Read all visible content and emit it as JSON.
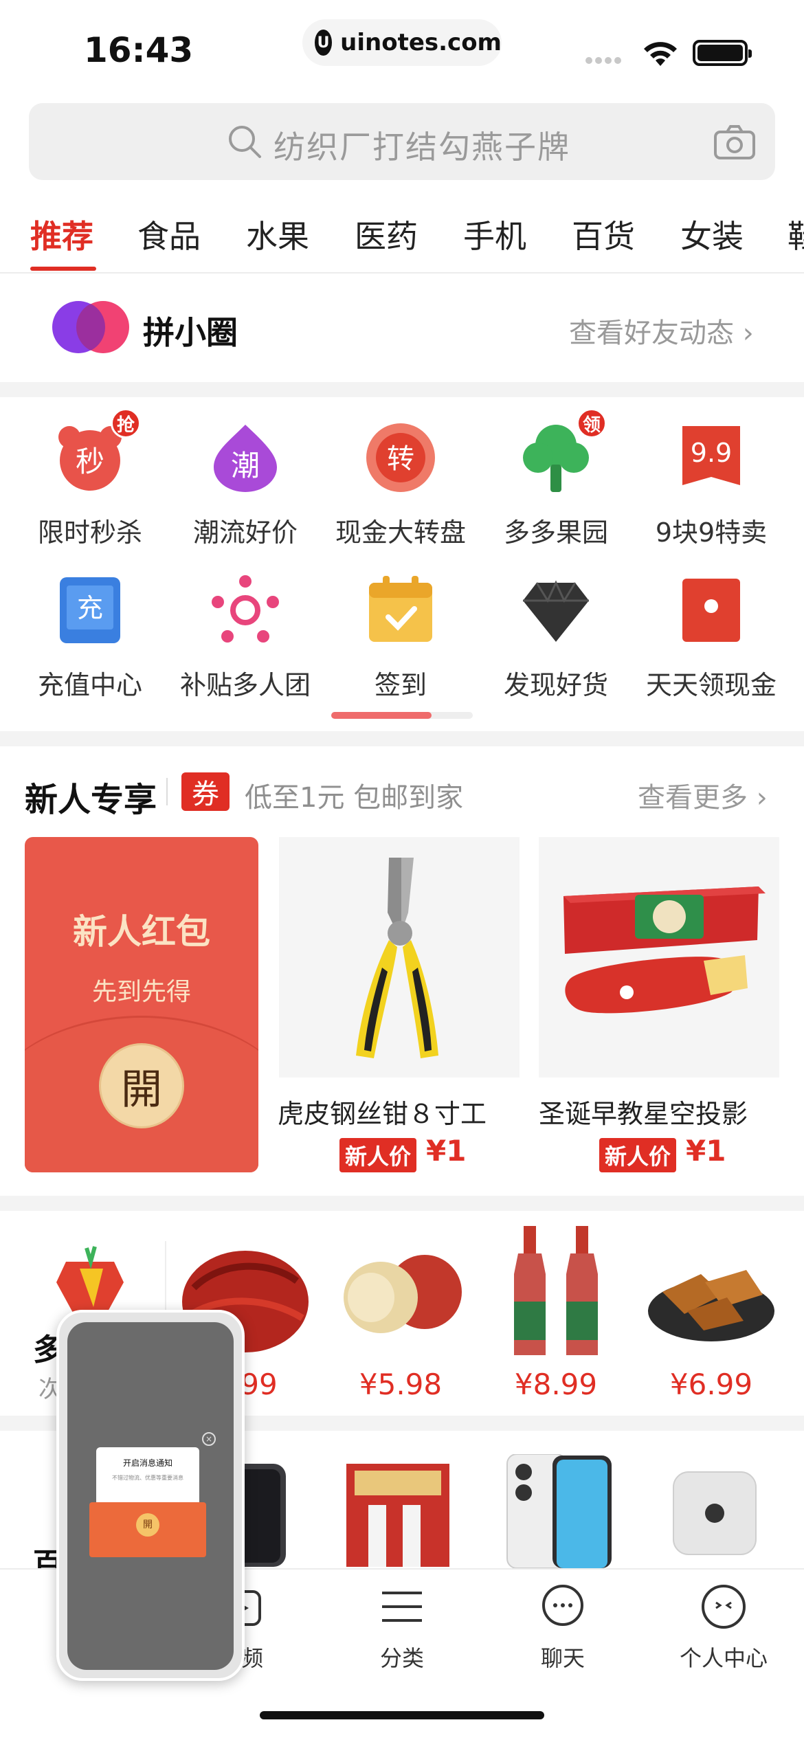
{
  "status_bar": {
    "time": "16:43",
    "url": "uinotes.com"
  },
  "search": {
    "placeholder": "纺织厂打结勾燕子牌"
  },
  "tabs": [
    {
      "label": "推荐",
      "active": true
    },
    {
      "label": "食品"
    },
    {
      "label": "水果"
    },
    {
      "label": "医药"
    },
    {
      "label": "手机"
    },
    {
      "label": "百货"
    },
    {
      "label": "女装"
    },
    {
      "label": "鞋"
    }
  ],
  "pin_circle": {
    "title": "拼小圈",
    "link": "查看好友动态"
  },
  "icon_grid": [
    {
      "label": "限时秒杀",
      "icon": "alarm-clock-icon",
      "glyph": "秒",
      "badge": "抢"
    },
    {
      "label": "潮流好价",
      "icon": "trend-flame-icon",
      "glyph": "潮"
    },
    {
      "label": "现金大转盘",
      "icon": "wheel-icon",
      "glyph": "转"
    },
    {
      "label": "多多果园",
      "icon": "tree-icon",
      "badge": "领"
    },
    {
      "label": "9块9特卖",
      "icon": "price-tag-icon",
      "glyph": "9.9"
    },
    {
      "label": "充值中心",
      "icon": "phone-topup-icon",
      "glyph": "充"
    },
    {
      "label": "补贴多人团",
      "icon": "group-people-icon"
    },
    {
      "label": "签到",
      "icon": "calendar-check-icon"
    },
    {
      "label": "发现好货",
      "icon": "diamond-icon"
    },
    {
      "label": "天天领现金",
      "icon": "red-envelope-icon"
    }
  ],
  "new_user": {
    "title": "新人专享",
    "coupon_tag": "券",
    "subtitle": "低至1元 包邮到家",
    "more": "查看更多",
    "red_packet": {
      "title": "新人红包",
      "sub": "先到先得",
      "button": "開"
    },
    "products": [
      {
        "title": "虎皮钢丝钳８寸工",
        "tag": "新人价",
        "price": "¥1"
      },
      {
        "title": "圣诞早教星空投影",
        "tag": "新人价",
        "price": "¥1"
      }
    ]
  },
  "product_row": {
    "partial_title": "多",
    "partial_sub": "次",
    "items": [
      {
        "price": "¥.99",
        "icon": "chili-peppers"
      },
      {
        "price": "¥5.98",
        "icon": "jujube-fruit"
      },
      {
        "price": "¥8.99",
        "icon": "liquor-bottles"
      },
      {
        "price": "¥6.99",
        "icon": "tofu-snack"
      }
    ]
  },
  "bottom_peek": {
    "partial_title": "百"
  },
  "tab_bar": [
    {
      "label": "视频",
      "icon": "video-icon"
    },
    {
      "label": "分类",
      "icon": "list-icon"
    },
    {
      "label": "聊天",
      "icon": "chat-bubble-icon"
    },
    {
      "label": "个人中心",
      "icon": "profile-face-icon"
    }
  ],
  "float_preview": {
    "popup_title": "开启消息通知",
    "popup_body": "不错过物流、优惠等重要消息",
    "coin": "開"
  },
  "colors": {
    "brand_red": "#e02e24",
    "page_gap": "#f3f3f3"
  }
}
